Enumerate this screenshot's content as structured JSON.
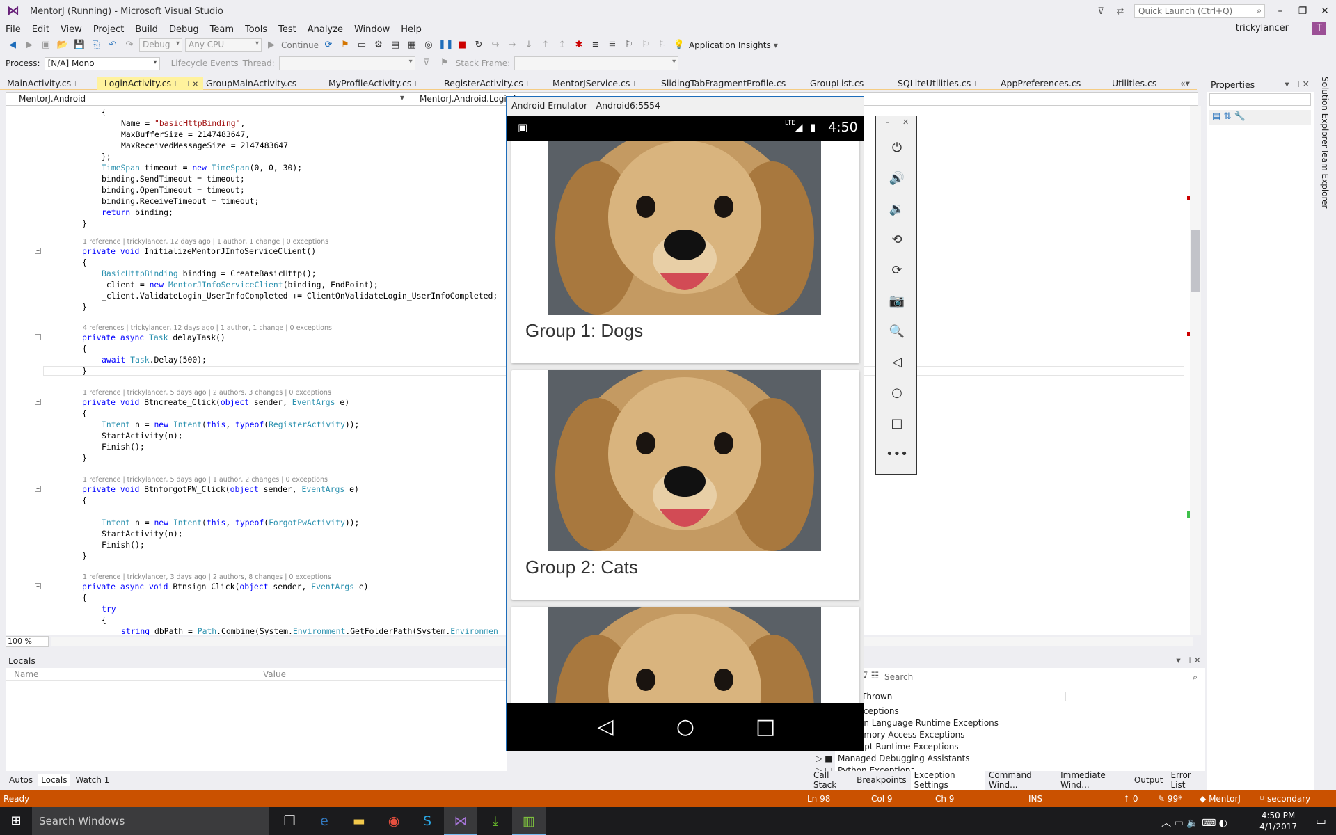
{
  "window": {
    "title": "MentorJ (Running) - Microsoft Visual Studio",
    "quick_launch_placeholder": "Quick Launch (Ctrl+Q)",
    "user": "trickylancer",
    "user_initial": "T"
  },
  "menu": [
    "File",
    "Edit",
    "View",
    "Project",
    "Build",
    "Debug",
    "Team",
    "Tools",
    "Test",
    "Analyze",
    "Window",
    "Help"
  ],
  "toolbar": {
    "configuration": "Debug",
    "platform": "Any CPU",
    "continue_label": "Continue",
    "insights_label": "Application Insights"
  },
  "debug_toolbar": {
    "process_label": "Process:",
    "process_value": "[N/A] Mono",
    "lifecycle_label": "Lifecycle Events",
    "thread_label": "Thread:",
    "stack_frame_label": "Stack Frame:"
  },
  "tabs": [
    {
      "label": "MainActivity.cs"
    },
    {
      "label": "LoginActivity.cs",
      "active": true
    },
    {
      "label": "GroupMainActivity.cs"
    },
    {
      "label": "MyProfileActivity.cs"
    },
    {
      "label": "RegisterActivity.cs"
    },
    {
      "label": "MentorJService.cs"
    },
    {
      "label": "SlidingTabFragmentProfile.cs"
    },
    {
      "label": "GroupList.cs"
    },
    {
      "label": "SQLiteUtilities.cs"
    },
    {
      "label": "AppPreferences.cs"
    },
    {
      "label": "Utilities.cs"
    }
  ],
  "navbar": {
    "project": "MentorJ.Android",
    "type": "MentorJ.Android.LoginA"
  },
  "code": {
    "l01": "{",
    "l02a": "Name = ",
    "l02b": "\"basicHttpBinding\"",
    "l02c": ",",
    "l03": "MaxBufferSize = 2147483647,",
    "l04": "MaxReceivedMessageSize = 2147483647",
    "l05": "};",
    "l06a": "TimeSpan",
    "l06b": " timeout = ",
    "l06c": "new",
    "l06d": " ",
    "l06e": "TimeSpan",
    "l06f": "(0, 0, 30);",
    "l07": "binding.SendTimeout = timeout;",
    "l08": "binding.OpenTimeout = timeout;",
    "l09": "binding.ReceiveTimeout = timeout;",
    "l10a": "return",
    "l10b": " binding;",
    "l11": "}",
    "lens1": "1 reference | trickylancer, 12 days ago | 1 author, 1 change | 0 exceptions",
    "l12a": "private",
    "l12b": " ",
    "l12c": "void",
    "l12d": " InitializeMentorJInfoServiceClient()",
    "l13": "{",
    "l14a": "BasicHttpBinding",
    "l14b": " binding = CreateBasicHttp();",
    "l15a": "_client = ",
    "l15b": "new",
    "l15c": " ",
    "l15d": "MentorJInfoServiceClient",
    "l15e": "(binding, EndPoint);",
    "l16": "_client.ValidateLogin_UserInfoCompleted += ClientOnValidateLogin_UserInfoCompleted;",
    "l17": "}",
    "lens2": "4 references | trickylancer, 12 days ago | 1 author, 1 change | 0 exceptions",
    "l18a": "private",
    "l18b": " ",
    "l18c": "async",
    "l18d": " ",
    "l18e": "Task",
    "l18f": " delayTask()",
    "l19": "{",
    "l20a": "await",
    "l20b": " ",
    "l20c": "Task",
    "l20d": ".Delay(500);",
    "l21": "}",
    "lens3": "1 reference | trickylancer, 5 days ago | 2 authors, 3 changes | 0 exceptions",
    "l22a": "private",
    "l22b": " ",
    "l22c": "void",
    "l22d": " Btncreate_Click(",
    "l22e": "object",
    "l22f": " sender, ",
    "l22g": "EventArgs",
    "l22h": " e)",
    "l23": "{",
    "l24a": "Intent",
    "l24b": " n = ",
    "l24c": "new",
    "l24d": " ",
    "l24e": "Intent",
    "l24f": "(",
    "l24g": "this",
    "l24h": ", ",
    "l24i": "typeof",
    "l24j": "(",
    "l24k": "RegisterActivity",
    "l24l": "));",
    "l25": "StartActivity(n);",
    "l26": "Finish();",
    "l27": "}",
    "lens4": "1 reference | trickylancer, 5 days ago | 1 author, 2 changes | 0 exceptions",
    "l28a": "private",
    "l28b": " ",
    "l28c": "void",
    "l28d": " BtnforgotPW_Click(",
    "l28e": "object",
    "l28f": " sender, ",
    "l28g": "EventArgs",
    "l28h": " e)",
    "l29": "{",
    "l30a": "Intent",
    "l30b": " n = ",
    "l30c": "new",
    "l30d": " ",
    "l30e": "Intent",
    "l30f": "(",
    "l30g": "this",
    "l30h": ", ",
    "l30i": "typeof",
    "l30j": "(",
    "l30k": "ForgotPwActivity",
    "l30l": "));",
    "l31": "StartActivity(n);",
    "l32": "Finish();",
    "l33": "}",
    "lens5": "1 reference | trickylancer, 3 days ago | 2 authors, 8 changes | 0 exceptions",
    "l34a": "private",
    "l34b": " ",
    "l34c": "async",
    "l34d": " ",
    "l34e": "void",
    "l34f": " Btnsign_Click(",
    "l34g": "object",
    "l34h": " sender, ",
    "l34i": "EventArgs",
    "l34j": " e)",
    "l35": "{",
    "l36": "try",
    "l37": "{",
    "l38a": "string",
    "l38b": " dbPath = ",
    "l38c": "Path",
    "l38d": ".Combine(System.",
    "l38e": "Environment",
    "l38f": ".GetFolderPath(System.",
    "l38g": "Environmen"
  },
  "zoom": "100 %",
  "locals": {
    "title": "Locals",
    "col_name": "Name",
    "col_value": "Value"
  },
  "bottom_tabs_left": [
    "Autos",
    "Locals",
    "Watch 1"
  ],
  "exceptions": {
    "title": "ttings",
    "search_placeholder": "Search",
    "col": "Thrown",
    "rows": [
      "xceptions",
      "on Language Runtime Exceptions",
      "emory Access Exceptions",
      "ript Runtime Exceptions",
      "Managed Debugging Assistants",
      "Python Exceptions"
    ]
  },
  "bottom_tabs_right": [
    "Call Stack",
    "Breakpoints",
    "Exception Settings",
    "Command Wind...",
    "Immediate Wind...",
    "Output",
    "Error List"
  ],
  "properties": {
    "title": "Properties"
  },
  "side_tabs": [
    "Solution Explorer",
    "Team Explorer"
  ],
  "emulator": {
    "title": "Android Emulator - Android6:5554",
    "time": "4:50",
    "network": "LTE",
    "groups": [
      {
        "title": "Group 1: Dogs"
      },
      {
        "title": "Group 2: Cats"
      },
      {
        "title": ""
      }
    ]
  },
  "status": {
    "ready": "Ready",
    "ln": "Ln 98",
    "col": "Col 9",
    "ch": "Ch 9",
    "mode": "INS",
    "up": "0",
    "pen": "99*",
    "repo": "MentorJ",
    "branch": "secondary"
  },
  "taskbar": {
    "search_placeholder": "Search Windows",
    "time": "4:50 PM",
    "date": "4/1/2017"
  },
  "colors": {
    "accent": "#68217a",
    "status_bar": "#ca5100",
    "active_tab": "#fff29d"
  }
}
